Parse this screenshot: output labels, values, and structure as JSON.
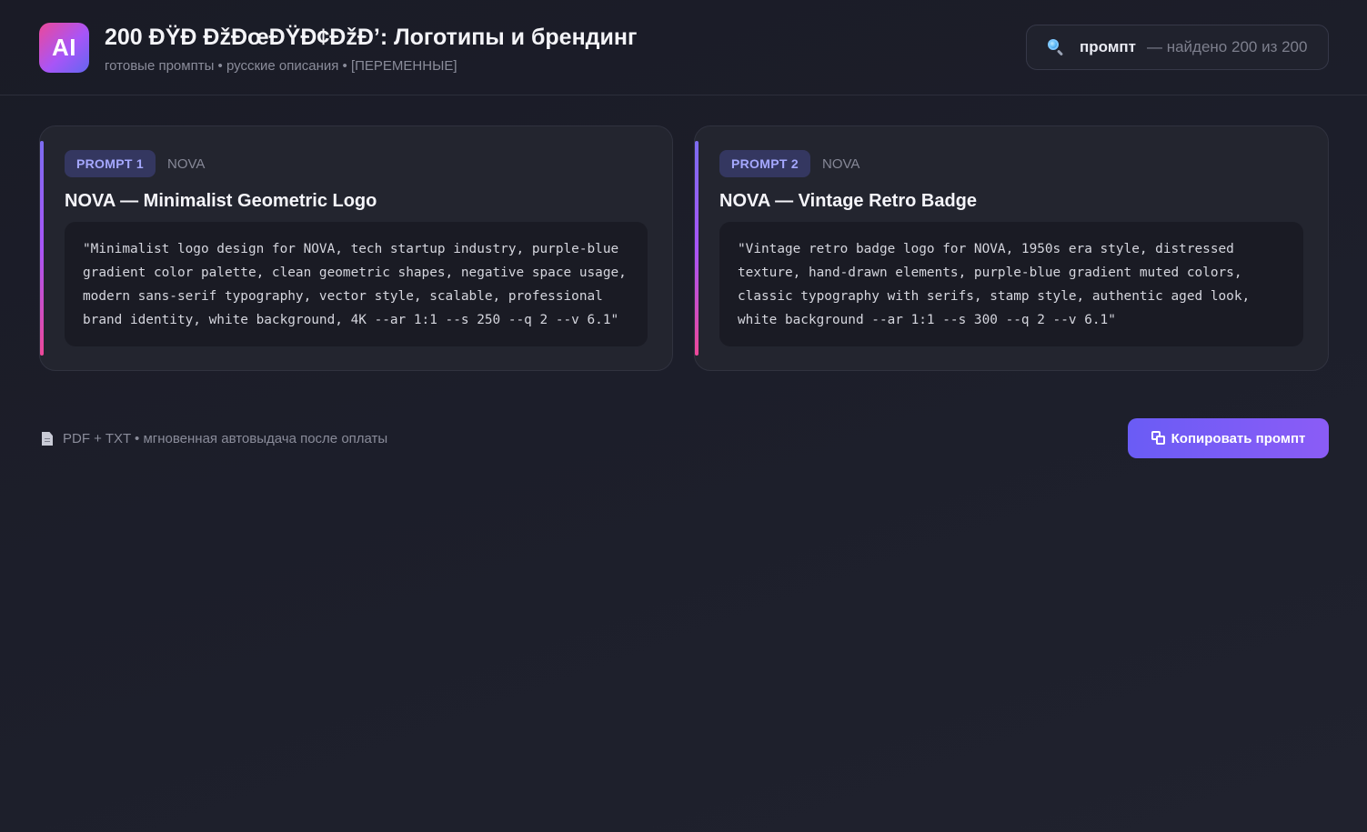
{
  "header": {
    "logo_text": "AI",
    "title": "200 ÐŸÐ ÐžÐœÐŸÐ¢ÐžÐ’: Логотипы и брендинг",
    "subtitle": "готовые промпты • русские описания • [ПЕРЕМЕННЫЕ]"
  },
  "search": {
    "icon": "magnifier-icon",
    "query": "промпт",
    "result_text": "— найдено 200 из 200"
  },
  "cards": [
    {
      "badge": "PROMPT 1",
      "brand": "NOVA",
      "title": "NOVA — Minimalist Geometric Logo",
      "prompt": "\"Minimalist logo design for NOVA, tech startup industry, purple-blue gradient color palette, clean geometric shapes, negative space usage, modern sans-serif typography, vector style, scalable, professional brand identity, white background, 4K --ar 1:1 --s 250 --q 2 --v 6.1\""
    },
    {
      "badge": "PROMPT 2",
      "brand": "NOVA",
      "title": "NOVA — Vintage Retro Badge",
      "prompt": "\"Vintage retro badge logo for NOVA, 1950s era style, distressed texture, hand-drawn elements, purple-blue gradient muted colors, classic typography with serifs, stamp style, authentic aged look, white background --ar 1:1 --s 300 --q 2 --v 6.1\""
    }
  ],
  "footer": {
    "icon": "document-icon",
    "note": "PDF + TXT • мгновенная автовыдача после оплаты",
    "copy_button_label": "Копировать промпт"
  },
  "colors": {
    "background": "#1a1b26",
    "card": "#23252f",
    "accent": "#6a5cf5",
    "badge_bg": "#343760",
    "badge_text": "#a5a8ff"
  }
}
